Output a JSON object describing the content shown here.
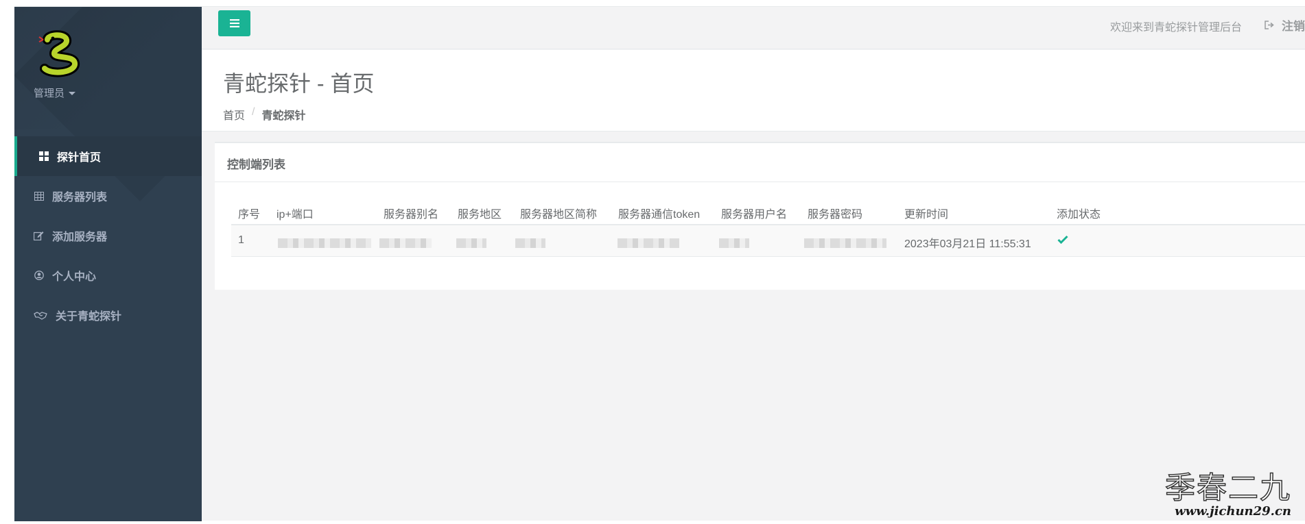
{
  "sidebar": {
    "user_label": "管理员",
    "items": [
      {
        "label": "探针首页",
        "icon": "dashboard-icon"
      },
      {
        "label": "服务器列表",
        "icon": "table-icon"
      },
      {
        "label": "添加服务器",
        "icon": "edit-icon"
      },
      {
        "label": "个人中心",
        "icon": "user-circle-icon"
      },
      {
        "label": "关于青蛇探针",
        "icon": "handshake-icon"
      }
    ]
  },
  "topbar": {
    "welcome": "欢迎来到青蛇探针管理后台",
    "logout": "注销"
  },
  "page": {
    "title": "青蛇探针 - 首页",
    "breadcrumb": [
      "首页",
      "青蛇探针"
    ]
  },
  "panel": {
    "title": "控制端列表",
    "columns": [
      "序号",
      "ip+端口",
      "服务器别名",
      "服务地区",
      "服务器地区简称",
      "服务器通信token",
      "服务器用户名",
      "服务器密码",
      "更新时间",
      "添加状态"
    ],
    "rows": [
      {
        "index": "1",
        "updated": "2023年03月21日 11:55:31",
        "status": "check-icon"
      }
    ]
  },
  "watermark": {
    "text": "季春二九",
    "url": "www.jichun29.cn"
  },
  "colors": {
    "sidebar_bg": "#2f4050",
    "accent": "#1ab394",
    "page_bg": "#f3f3f4"
  }
}
